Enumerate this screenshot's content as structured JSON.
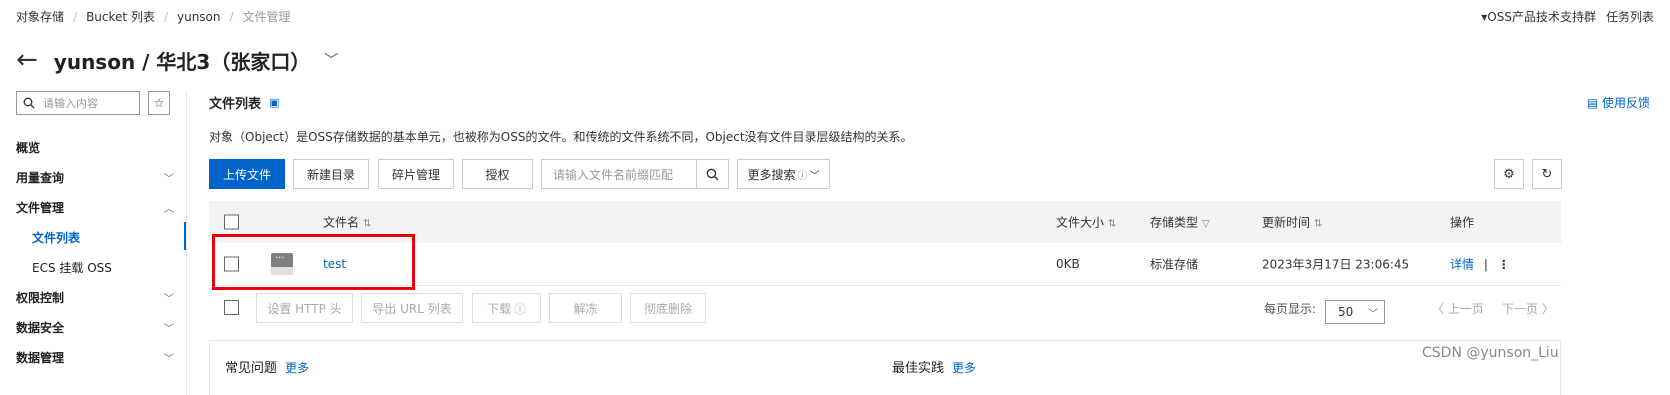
{
  "breadcrumb": [
    "对象存储",
    "Bucket 列表",
    "yunson",
    "文件管理"
  ],
  "topright": [
    "OSS产品技术支持群",
    "任务列表"
  ],
  "title": "yunson / 华北3（张家口）",
  "sidebar": {
    "search_placeholder": "请输入内容",
    "items": [
      {
        "label": "概览"
      },
      {
        "label": "用量查询"
      },
      {
        "label": "文件管理"
      },
      {
        "label": "文件列表"
      },
      {
        "label": "ECS 挂载 OSS"
      },
      {
        "label": "权限控制"
      },
      {
        "label": "数据安全"
      },
      {
        "label": "数据管理"
      }
    ]
  },
  "section_title": "文件列表",
  "feedback": "使用反馈",
  "description": "对象（Object）是OSS存储数据的基本单元，也被称为OSS的文件。和传统的文件系统不同，Object没有文件目录层级结构的关系。",
  "toolbar": {
    "upload": "上传文件",
    "new_dir": "新建目录",
    "fragments": "碎片管理",
    "authorize": "授权",
    "search_placeholder": "请输入文件名前缀匹配",
    "more_search": "更多搜索"
  },
  "table": {
    "headers": {
      "name": "文件名",
      "size": "文件大小",
      "storage": "存储类型",
      "updated": "更新时间",
      "actions": "操作"
    },
    "rows": [
      {
        "name": "test",
        "size": "0KB",
        "storage": "标准存储",
        "updated": "2023年3月17日 23:06:45",
        "detail": "详情",
        "divider": "|"
      }
    ]
  },
  "bulk": {
    "set_http": "设置 HTTP 头",
    "export_url": "导出 URL 列表",
    "download": "下载",
    "unfreeze": "解冻",
    "delete": "彻底删除"
  },
  "pagination": {
    "label": "每页显示:",
    "size": "50",
    "prev": "上一页",
    "next": "下一页"
  },
  "footer": {
    "faq": "常见问题",
    "faq_more": "更多",
    "best": "最佳实践",
    "best_more": "更多"
  },
  "watermark": "CSDN @yunson_Liu",
  "colors": {
    "accent": "#0064c8",
    "highlight": "#e8000b"
  }
}
